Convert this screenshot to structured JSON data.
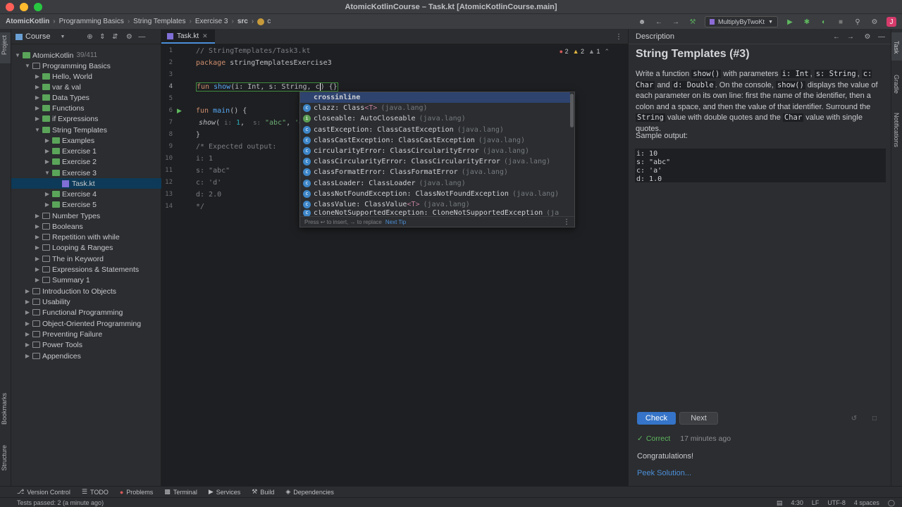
{
  "window": {
    "title": "AtomicKotlinCourse – Task.kt [AtomicKotlinCourse.main]",
    "traffic_colors": [
      "#fe5f57",
      "#febc2e",
      "#28c840"
    ]
  },
  "breadcrumbs": [
    "AtomicKotlin",
    "Programming Basics",
    "String Templates",
    "Exercise 3",
    "src",
    "c"
  ],
  "run_config": "MultiplyByTwoKt",
  "left_stripe": {
    "project": "Project",
    "bookmarks": "Bookmarks",
    "structure": "Structure"
  },
  "right_stripe": {
    "task": "Task",
    "gradle": "Gradle",
    "notifications": "Notifications"
  },
  "project_panel": {
    "header": "Course",
    "root": {
      "label": "AtomicKotlin",
      "count": "39/411"
    },
    "items": [
      "Programming Basics",
      "Hello, World",
      "var & val",
      "Data Types",
      "Functions",
      "if Expressions",
      "String Templates",
      "Examples",
      "Exercise 1",
      "Exercise 2",
      "Exercise 3",
      "Task.kt",
      "Exercise 4",
      "Exercise 5",
      "Number Types",
      "Booleans",
      "Repetition with while",
      "Looping & Ranges",
      "The in Keyword",
      "Expressions & Statements",
      "Summary 1",
      "Introduction to Objects",
      "Usability",
      "Functional Programming",
      "Object-Oriented Programming",
      "Preventing Failure",
      "Power Tools",
      "Appendices"
    ]
  },
  "editor": {
    "tab": "Task.kt",
    "inspections": {
      "errors": "2",
      "warnings": "2",
      "weak": "1"
    },
    "line_numbers": [
      "1",
      "2",
      "3",
      "4",
      "5",
      "6",
      "7",
      "8",
      "9",
      "10",
      "11",
      "12",
      "13",
      "14"
    ],
    "line1": "// StringTemplates/Task3.kt",
    "line3_kw": "package",
    "line3_rest": " stringTemplatesExercise3",
    "line5_kw": "fun",
    "line5_fn": "show",
    "line5_rest": "(i: Int, s: String, c",
    "line5_tail": ") {}",
    "line7_kw": "fun",
    "line7_fn": "main",
    "line7_rest": "() {",
    "line8_fn": "show",
    "line8_hint_i": "i:",
    "line8_num": "1",
    "line8_hint_s": "s:",
    "line8_str": "\"abc\"",
    "line8_trunc": "'d'",
    "line9": "}",
    "comment_lines": [
      "/* Expected output:",
      "i: 1",
      "s: \"abc\"",
      "c: 'd'",
      "d: 2.0",
      "*/"
    ]
  },
  "completion": {
    "items": [
      {
        "name": "crossinline",
        "type": "",
        "pkg": "",
        "icon": ""
      },
      {
        "name": "clazz: Class",
        "type": "<T>",
        "pkg": "(java.lang)",
        "icon": "c"
      },
      {
        "name": "closeable: AutoCloseable",
        "type": "",
        "pkg": "(java.lang)",
        "icon": "i"
      },
      {
        "name": "castException: ClassCastException",
        "type": "",
        "pkg": "(java.lang)",
        "icon": "c"
      },
      {
        "name": "classCastException: ClassCastException",
        "type": "",
        "pkg": "(java.lang)",
        "icon": "c"
      },
      {
        "name": "circularityError: ClassCircularityError",
        "type": "",
        "pkg": "(java.lang)",
        "icon": "c"
      },
      {
        "name": "classCircularityError: ClassCircularityError",
        "type": "",
        "pkg": "(java.lang)",
        "icon": "c"
      },
      {
        "name": "classFormatError: ClassFormatError",
        "type": "",
        "pkg": "(java.lang)",
        "icon": "c"
      },
      {
        "name": "classLoader: ClassLoader",
        "type": "",
        "pkg": "(java.lang)",
        "icon": "c"
      },
      {
        "name": "classNotFoundException: ClassNotFoundException",
        "type": "",
        "pkg": "(java.lang)",
        "icon": "c"
      },
      {
        "name": "classValue: ClassValue",
        "type": "<T>",
        "pkg": "(java.lang)",
        "icon": "c"
      },
      {
        "name": "cloneNotSupportedException: CloneNotSupportedException",
        "type": "",
        "pkg": "(ja",
        "icon": "c"
      }
    ],
    "footer": "Press ↩ to insert, → to replace",
    "next_tip": "Next Tip"
  },
  "description": {
    "header": "Description",
    "title": "String Templates (#3)",
    "p1": "Write a function",
    "c1": "show()",
    "p2": "with parameters",
    "c2": "i: Int",
    "p3": ",",
    "c3": "s: String",
    "p4": ",",
    "c4": "c: Char",
    "p5": "and",
    "c5": "d: Double",
    "p6": ". On the console,",
    "c6": "show()",
    "p7": "displays the value of each parameter on its own line: first the name of the identifier, then a colon and a space, and then the value of that identifier. Surround the",
    "c7": "String",
    "p8": "value with double quotes and the",
    "c8": "Char",
    "p9": "value with single quotes.",
    "sample_label": "Sample output:",
    "sample": "i: 10\ns: \"abc\"\nc: 'a'\nd: 1.0",
    "check_label": "Check",
    "next_label": "Next",
    "status_correct": "Correct",
    "status_time": "17 minutes ago",
    "congrats": "Congratulations!",
    "peek": "Peek Solution..."
  },
  "toolwindows": [
    "Version Control",
    "TODO",
    "Problems",
    "Terminal",
    "Services",
    "Build",
    "Dependencies"
  ],
  "statusbar": {
    "left": "Tests passed: 2 (a minute ago)",
    "position": "4:30",
    "line_sep": "LF",
    "encoding": "UTF-8",
    "indent": "4 spaces"
  }
}
